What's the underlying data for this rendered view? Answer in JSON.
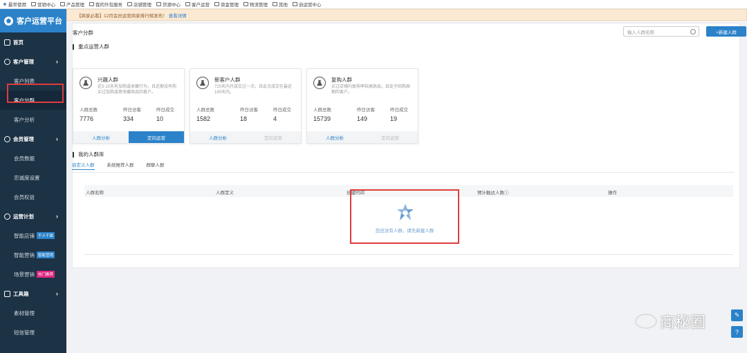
{
  "topbar": {
    "items": [
      "最常使用",
      "营销中心",
      "产品管理",
      "我的外包服务",
      "店铺管理",
      "货源中心",
      "客户运营",
      "资金管理",
      "物流管理",
      "其他",
      "自运营中心"
    ]
  },
  "sidebar": {
    "brand": "客户运营平台",
    "items": [
      {
        "label": "首页",
        "type": "group"
      },
      {
        "label": "客户管理",
        "type": "group"
      },
      {
        "label": "客户列表",
        "type": "sub"
      },
      {
        "label": "客户分群",
        "type": "sub"
      },
      {
        "label": "客户分析",
        "type": "sub"
      },
      {
        "label": "会员管理",
        "type": "group"
      },
      {
        "label": "会员数据",
        "type": "sub"
      },
      {
        "label": "忠诚度设置",
        "type": "sub"
      },
      {
        "label": "会员权益",
        "type": "sub"
      },
      {
        "label": "运营计划",
        "type": "group"
      },
      {
        "label": "智能店铺",
        "type": "sub",
        "tag": "千人千面",
        "tag_color": "#2b82c9"
      },
      {
        "label": "智能营销",
        "type": "sub",
        "tag": "智能营销",
        "tag_color": "#2b82c9"
      },
      {
        "label": "场景营销",
        "type": "sub",
        "tag": "热门推荐",
        "tag_color": "#e0247f"
      },
      {
        "label": "工具箱",
        "type": "group"
      },
      {
        "label": "素材管理",
        "type": "sub"
      },
      {
        "label": "短信管理",
        "type": "sub"
      }
    ]
  },
  "notice": {
    "text": "【商家必看】12月会员运营商家排行榜发布！",
    "link": "查看详情"
  },
  "page": {
    "title": "客户分群",
    "search_placeholder": "输入人群名称",
    "new_button": "+新建人群"
  },
  "key_section": {
    "title": "重点运营人群"
  },
  "cards": [
    {
      "title": "兴趣人群",
      "desc": "近3-10天有加购或收藏行为，且近期没有购买过加购或者收藏商品的客户。",
      "stat_labels": [
        "人群总数",
        "昨日访客",
        "昨日成交"
      ],
      "stat_values": [
        "7776",
        "334",
        "10"
      ],
      "btn1": "人群分析",
      "btn2": "定向运营",
      "btn2_state": "primary"
    },
    {
      "title": "新客户人群",
      "desc": "720天内只成交过一次，且此次成交在最近180天内。",
      "stat_labels": [
        "人群总数",
        "昨日访客",
        "昨日成交"
      ],
      "stat_values": [
        "1582",
        "18",
        "4"
      ],
      "btn1": "人群分析",
      "btn2": "定向运营",
      "btn2_state": "disabled"
    },
    {
      "title": "复购人群",
      "desc": "买过店铺内复购率较高商品，且处于回购周期的客户。",
      "stat_labels": [
        "人群总数",
        "昨日访客",
        "昨日成交"
      ],
      "stat_values": [
        "15739",
        "149",
        "19"
      ],
      "btn1": "人群分析",
      "btn2": "定向运营",
      "btn2_state": "disabled"
    }
  ],
  "my_section": {
    "title": "我的人群库"
  },
  "tabs": [
    "自定义人群",
    "系统推荐人群",
    "群聊人群"
  ],
  "table": {
    "columns": [
      "人群名称",
      "人群定义",
      "创建时间",
      "预计触达人数ⓘ",
      "操作"
    ]
  },
  "empty": {
    "text": "您还没有人群，请先新建人群"
  },
  "watermark": {
    "text": "商秘圈"
  },
  "float_buttons": [
    "✎",
    "?"
  ]
}
